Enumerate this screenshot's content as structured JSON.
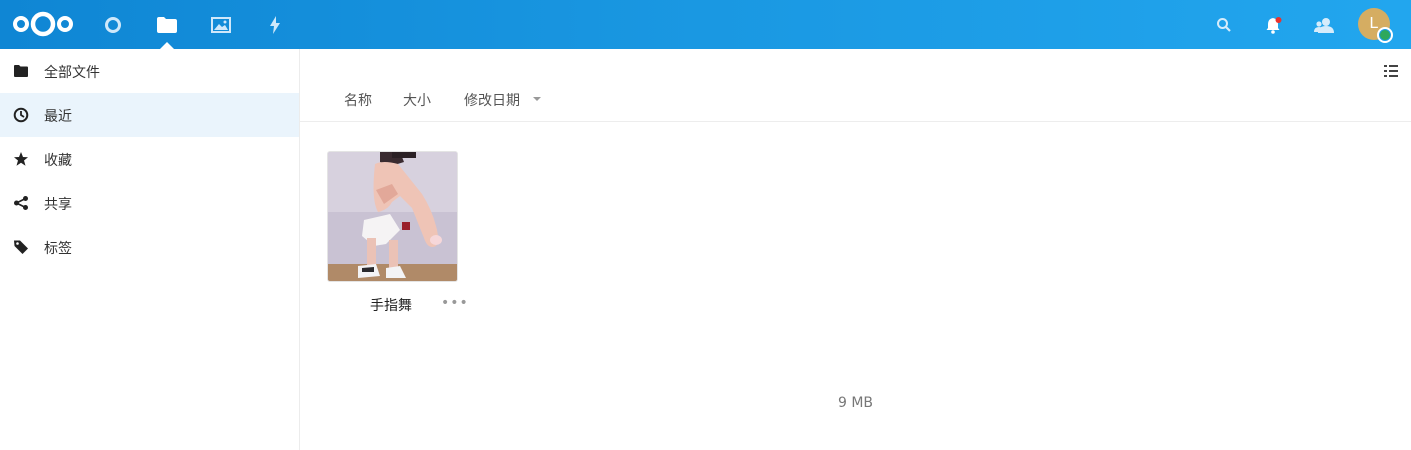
{
  "header": {
    "apps": [
      {
        "name": "dashboard",
        "icon": "circle-icon"
      },
      {
        "name": "files",
        "icon": "folder-icon",
        "active": true
      },
      {
        "name": "photos",
        "icon": "image-icon"
      },
      {
        "name": "activity",
        "icon": "lightning-icon"
      }
    ],
    "right_icons": [
      "search-icon",
      "bell-icon",
      "contacts-icon"
    ],
    "avatar_initial": "L",
    "accent": "#1b9de6",
    "notification_color": "#e9322d"
  },
  "sidebar": {
    "items": [
      {
        "label": "全部文件",
        "icon": "folder-icon"
      },
      {
        "label": "最近",
        "icon": "clock-icon",
        "active": true
      },
      {
        "label": "收藏",
        "icon": "star-icon"
      },
      {
        "label": "共享",
        "icon": "share-icon"
      },
      {
        "label": "标签",
        "icon": "tag-icon"
      }
    ]
  },
  "main": {
    "sort_columns": {
      "name": "名称",
      "size": "大小",
      "modified": "修改日期"
    },
    "files": [
      {
        "name": "手指舞",
        "actions": "•••"
      }
    ],
    "summary_size": "9 MB"
  }
}
